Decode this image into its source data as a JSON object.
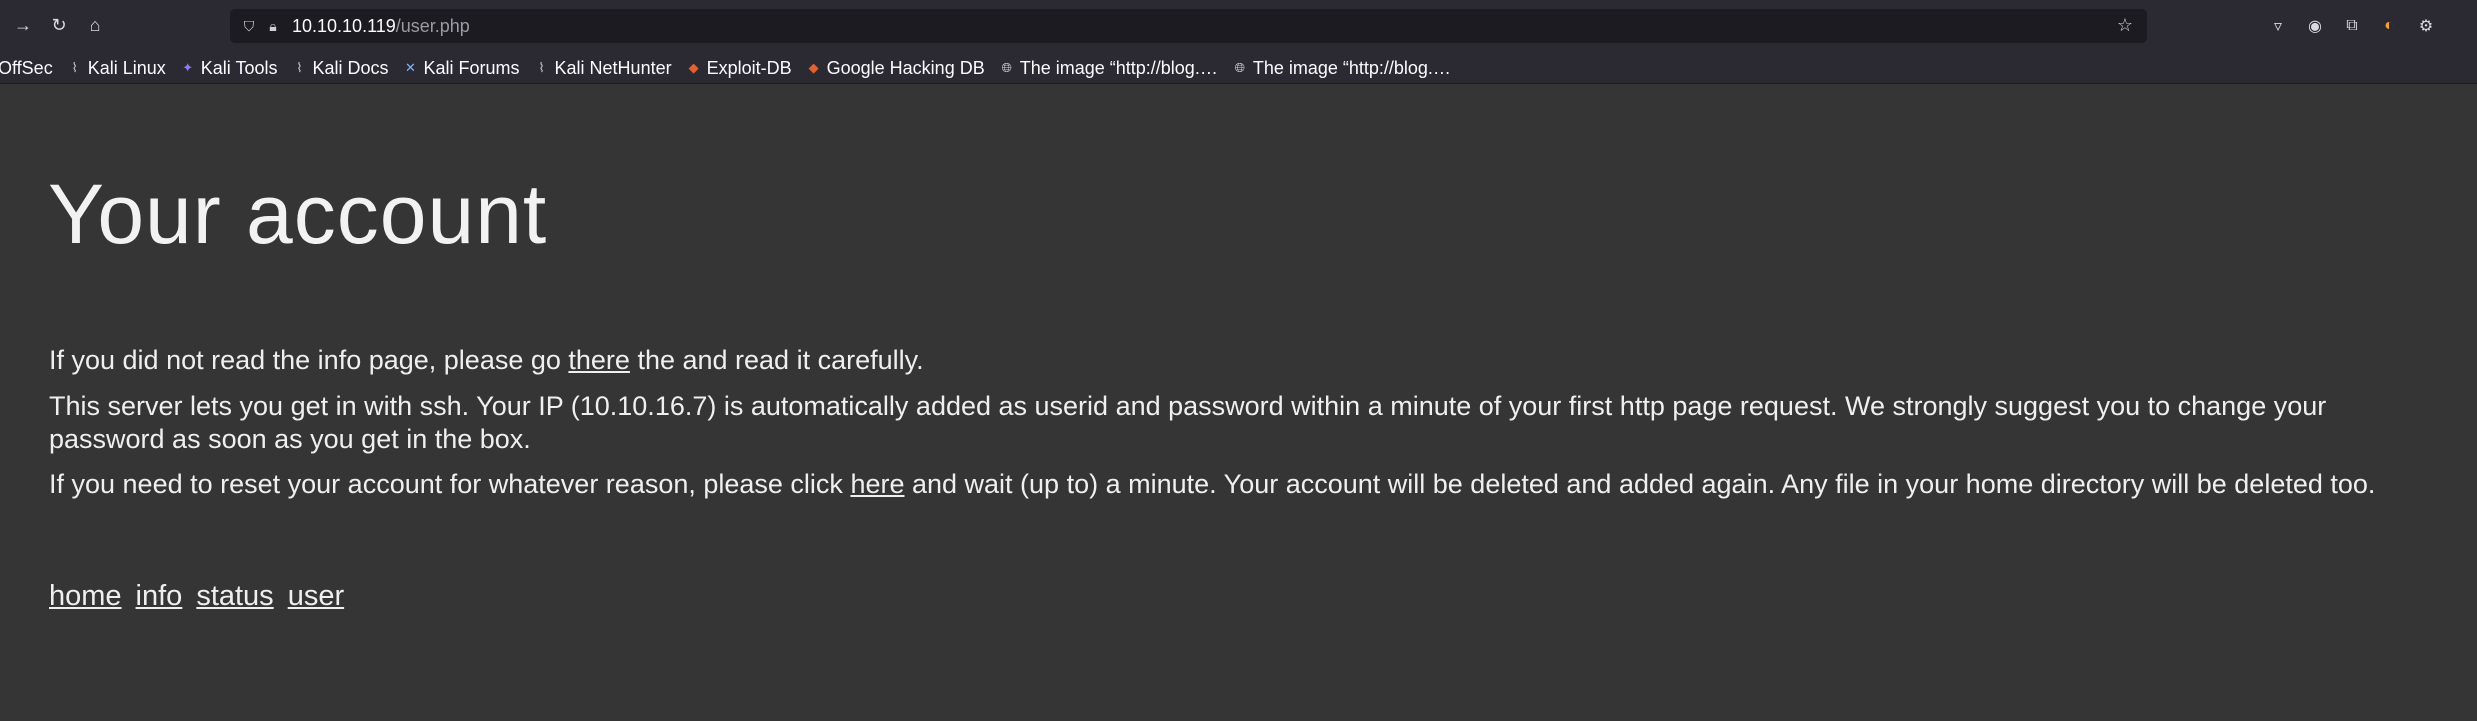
{
  "browser": {
    "url_host": "10.10.10.119",
    "url_path": "/user.php",
    "icons": [
      "back-icon",
      "reload-icon",
      "home-icon",
      "shield-icon",
      "lock-icon",
      "star-icon",
      "pocket-icon",
      "account-icon",
      "extensions-icon",
      "extension-icon",
      "settings-icon"
    ]
  },
  "bookmarks": [
    {
      "label": "OffSec",
      "icon": "offsec-icon"
    },
    {
      "label": "Kali Linux",
      "icon": "kali-icon"
    },
    {
      "label": "Kali Tools",
      "icon": "kali-tools-icon"
    },
    {
      "label": "Kali Docs",
      "icon": "kali-icon"
    },
    {
      "label": "Kali Forums",
      "icon": "kali-forums-icon"
    },
    {
      "label": "Kali NetHunter",
      "icon": "kali-icon"
    },
    {
      "label": "Exploit-DB",
      "icon": "exploitdb-icon"
    },
    {
      "label": "Google Hacking DB",
      "icon": "exploitdb-icon"
    },
    {
      "label": "The image “http://blog.…",
      "icon": "globe-icon"
    },
    {
      "label": "The image “http://blog.…",
      "icon": "globe-icon"
    }
  ],
  "page": {
    "title": "Your account",
    "p1_before": "If you did not read the info page, please go ",
    "p1_link": "there",
    "p1_after": " the and read it carefully.",
    "p2": "This server lets you get in with ssh. Your IP (10.10.16.7) is automatically added as userid and password within a minute of your first http page request. We strongly suggest you to change your password as soon as you get in the box.",
    "p3_before": "If you need to reset your account for whatever reason, please click ",
    "p3_link": "here",
    "p3_after": " and wait (up to) a minute. Your account will be deleted and added again. Any file in your home directory will be deleted too.",
    "menu": [
      "home",
      "info",
      "status",
      "user"
    ]
  },
  "colors": {
    "page_bg": "#353535",
    "chrome_bg": "#2b2a33",
    "urlbar_bg": "#1c1b22",
    "text": "#efefef"
  }
}
